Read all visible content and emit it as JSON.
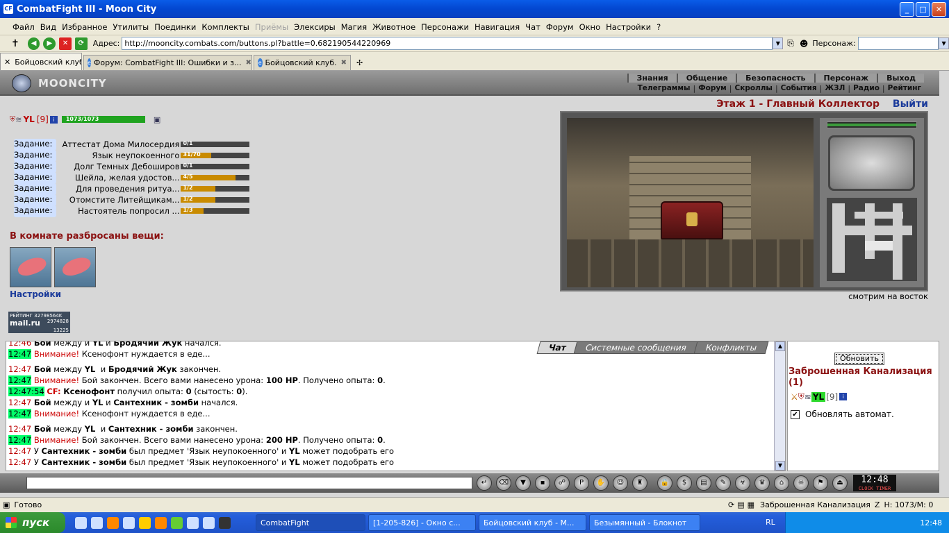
{
  "window": {
    "title": "CombatFight III - Moon City",
    "app_icon": "CF"
  },
  "menu": [
    "Файл",
    "Вид",
    "Избранное",
    "Утилиты",
    "Поединки",
    "Комплекты",
    "Приёмы",
    "Элексиры",
    "Магия",
    "Животное",
    "Персонажи",
    "Навигация",
    "Чат",
    "Форум",
    "Окно",
    "Настройки",
    "?"
  ],
  "menu_disabled": "Приёмы",
  "address": {
    "label": "Адрес:",
    "url": "http://mooncity.combats.com/buttons.pl?battle=0.682190544220969",
    "persona_label": "Персонаж:"
  },
  "tabs": [
    {
      "label": "Бойцовский клуб",
      "active": true
    },
    {
      "label": "Форум: CombatFight III: Ошибки и з...",
      "active": false
    },
    {
      "label": "Бойцовский клуб.",
      "active": false
    }
  ],
  "header": {
    "logo": "MOONCITY",
    "nav1": [
      "Знания",
      "Общение",
      "Безопасность",
      "Персонаж",
      "Выход"
    ],
    "nav2": [
      "Телеграммы",
      "Форум",
      "Скроллы",
      "События",
      "ЖЗЛ",
      "Радио",
      "Рейтинг"
    ]
  },
  "character": {
    "name": "YL",
    "level": "[9]",
    "hp": "1073/1073",
    "hp_fraction": 1.0
  },
  "quests": [
    {
      "label": "Задание:",
      "text": "Аттестат Дома Милосердия",
      "progress": "0/1",
      "fill": 0.0
    },
    {
      "label": "Задание:",
      "text": "Язык неупокоенного",
      "progress": "31/70",
      "fill": 0.44
    },
    {
      "label": "Задание:",
      "text": "Долг Темных Дебоширов",
      "progress": "0/1",
      "fill": 0.0
    },
    {
      "label": "Задание:",
      "text": "Шейла, желая удостов...",
      "progress": "4/5",
      "fill": 0.8
    },
    {
      "label": "Задание:",
      "text": "Для проведения ритуа...",
      "progress": "1/2",
      "fill": 0.5
    },
    {
      "label": "Задание:",
      "text": "Отомстите Литейщикам...",
      "progress": "1/2",
      "fill": 0.5
    },
    {
      "label": "Задание:",
      "text": "Настоятель попросил ...",
      "progress": "1/3",
      "fill": 0.33
    }
  ],
  "room": {
    "items_title": "В комнате разбросаны вещи:",
    "settings": "Настройки"
  },
  "rating": {
    "label": "РЕЙТИНГ",
    "num1": "32798564K",
    "brand": "mail.ru",
    "num2": "2974828",
    "num3": "13225"
  },
  "location": {
    "title": "Этаж 1 - Главный Коллектор",
    "exit": "Выйти",
    "facing": "смотрим на восток"
  },
  "chat": {
    "tabs": [
      "Чат",
      "Системные сообщения",
      "Конфликты"
    ],
    "lines": [
      {
        "ts": "12:46",
        "g": false,
        "parts": [
          [
            "b",
            "Бой"
          ],
          [
            "t",
            " между и "
          ],
          [
            "b",
            "YL"
          ],
          [
            "t",
            " и "
          ],
          [
            "b",
            "Бродячий Жук"
          ],
          [
            "t",
            " начался."
          ]
        ]
      },
      {
        "ts": "12:47",
        "g": true,
        "parts": [
          [
            "w",
            "Внимание!"
          ],
          [
            "t",
            " Ксенофонт нуждается в еде..."
          ]
        ]
      },
      {
        "ts": "12:47",
        "g": false,
        "gap": true,
        "parts": [
          [
            "b",
            "Бой"
          ],
          [
            "t",
            " между "
          ],
          [
            "b",
            "YL"
          ],
          [
            "t",
            "  и "
          ],
          [
            "b",
            "Бродячий Жук"
          ],
          [
            "t",
            " закончен."
          ]
        ]
      },
      {
        "ts": "12:47",
        "g": true,
        "parts": [
          [
            "w",
            "Внимание!"
          ],
          [
            "t",
            " Бой закончен. Всего вами нанесено урона: "
          ],
          [
            "b",
            "100 HP"
          ],
          [
            "t",
            ". Получено опыта: "
          ],
          [
            "b",
            "0"
          ],
          [
            "t",
            "."
          ]
        ]
      },
      {
        "ts": "12:47:54",
        "g": true,
        "parts": [
          [
            "c",
            "CF:"
          ],
          [
            "t",
            " "
          ],
          [
            "b",
            "Ксенофонт"
          ],
          [
            "t",
            " получил опыта: "
          ],
          [
            "b",
            "0"
          ],
          [
            "t",
            " (сытость: "
          ],
          [
            "b",
            "0"
          ],
          [
            "t",
            ")."
          ]
        ]
      },
      {
        "ts": "12:47",
        "g": false,
        "parts": [
          [
            "b",
            "Бой"
          ],
          [
            "t",
            " между и "
          ],
          [
            "b",
            "YL"
          ],
          [
            "t",
            " и "
          ],
          [
            "b",
            "Сантехник - зомби"
          ],
          [
            "t",
            " начался."
          ]
        ]
      },
      {
        "ts": "12:47",
        "g": true,
        "parts": [
          [
            "w",
            "Внимание!"
          ],
          [
            "t",
            " Ксенофонт нуждается в еде..."
          ]
        ]
      },
      {
        "ts": "12:47",
        "g": false,
        "gap": true,
        "parts": [
          [
            "b",
            "Бой"
          ],
          [
            "t",
            " между "
          ],
          [
            "b",
            "YL"
          ],
          [
            "t",
            "  и "
          ],
          [
            "b",
            "Сантехник - зомби"
          ],
          [
            "t",
            " закончен."
          ]
        ]
      },
      {
        "ts": "12:47",
        "g": true,
        "parts": [
          [
            "w",
            "Внимание!"
          ],
          [
            "t",
            " Бой закончен. Всего вами нанесено урона: "
          ],
          [
            "b",
            "200 HP"
          ],
          [
            "t",
            ". Получено опыта: "
          ],
          [
            "b",
            "0"
          ],
          [
            "t",
            "."
          ]
        ]
      },
      {
        "ts": "12:47",
        "g": false,
        "parts": [
          [
            "t",
            "У "
          ],
          [
            "b",
            "Сантехник - зомби"
          ],
          [
            "t",
            " был предмет 'Язык неупокоенного' и "
          ],
          [
            "b",
            "YL"
          ],
          [
            "t",
            " может подобрать его"
          ]
        ]
      },
      {
        "ts": "12:47",
        "g": false,
        "parts": [
          [
            "t",
            "У "
          ],
          [
            "b",
            "Сантехник - зомби"
          ],
          [
            "t",
            " был предмет 'Язык неупокоенного' и "
          ],
          [
            "b",
            "YL"
          ],
          [
            "t",
            " может подобрать его"
          ]
        ]
      }
    ]
  },
  "side": {
    "refresh": "Обновить",
    "location": "Заброшенная Канализация",
    "count": "(1)",
    "online_name": "YL",
    "online_level": "[9]",
    "auto_label": "Обновлять автомат.",
    "auto_checked": true
  },
  "clock": {
    "time": "12:48",
    "labels": "CLOCK  TIMER"
  },
  "status": {
    "left": "Готово",
    "location": "Заброшенная Канализация",
    "hp": "H: 1073/M: 0"
  },
  "taskbar": {
    "start": "пуск",
    "tasks": [
      "CombatFight",
      "[1-205-826] - Окно с...",
      "Бойцовский клуб - M...",
      "Безымянный - Блокнот"
    ],
    "lang": "RL",
    "time": "12:48"
  }
}
